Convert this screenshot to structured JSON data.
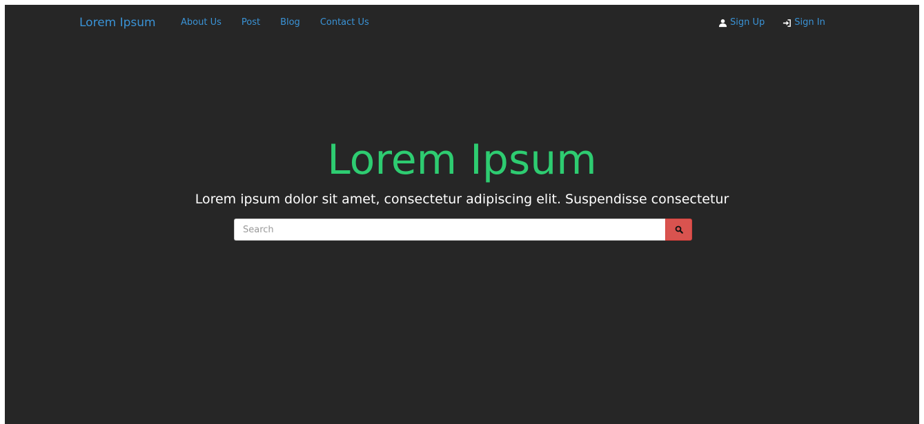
{
  "navbar": {
    "brand": "Lorem Ipsum",
    "left_links": [
      {
        "label": "About Us"
      },
      {
        "label": "Post"
      },
      {
        "label": "Blog"
      },
      {
        "label": "Contact Us"
      }
    ],
    "right_links": [
      {
        "label": "Sign Up",
        "icon": "user-icon"
      },
      {
        "label": "Sign In",
        "icon": "sign-in-icon"
      }
    ]
  },
  "hero": {
    "title": "Lorem Ipsum",
    "subtitle": "Lorem ipsum dolor sit amet, consectetur adipiscing elit. Suspendisse consectetur"
  },
  "search": {
    "placeholder": "Search",
    "value": "",
    "button_icon": "search-icon"
  },
  "colors": {
    "background": "#262626",
    "link": "#3a93d6",
    "title": "#2ecc71",
    "search_button": "#d9534f"
  }
}
